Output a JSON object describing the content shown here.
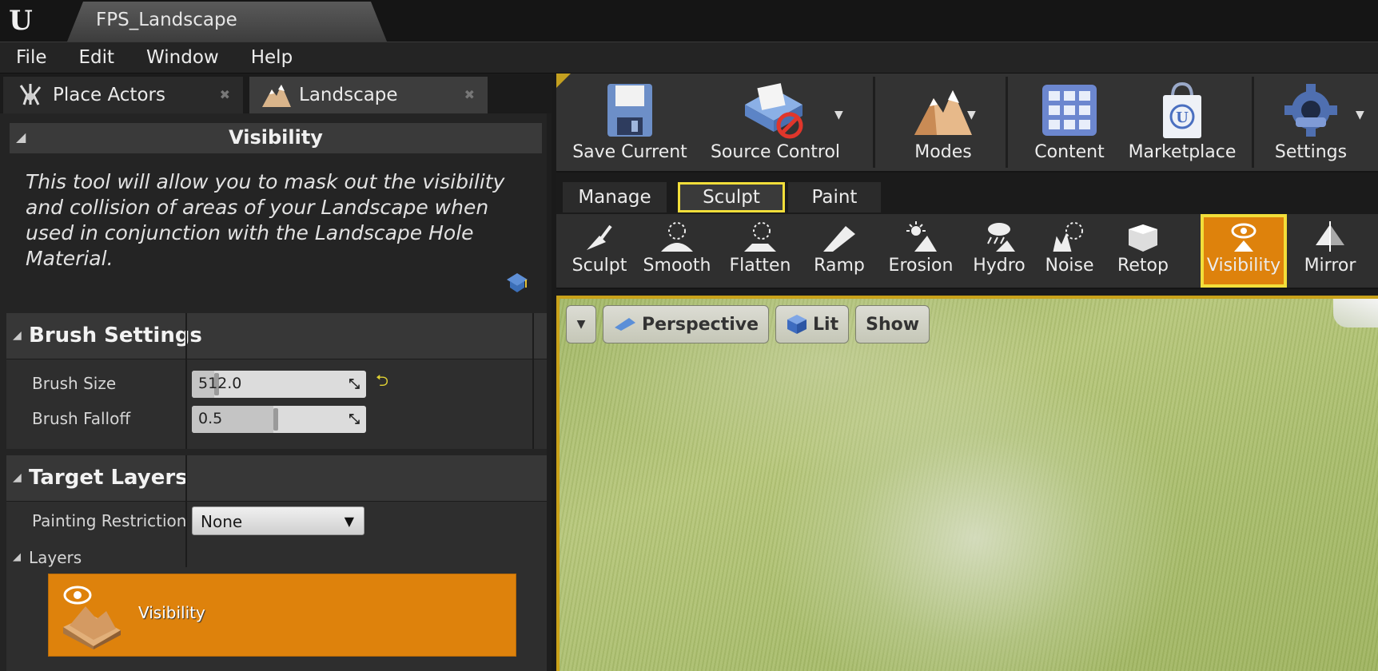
{
  "app": {
    "document_tab": "FPS_Landscape"
  },
  "menu": [
    "File",
    "Edit",
    "Window",
    "Help"
  ],
  "panel_tabs": {
    "place_actors": "Place Actors",
    "landscape": "Landscape"
  },
  "tool": {
    "title": "Visibility",
    "description": "This tool will allow you to mask out the visibility and collision of areas of your Landscape when used in conjunction with the Landscape Hole Material."
  },
  "brush_settings": {
    "title": "Brush Settings",
    "brush_size_label": "Brush Size",
    "brush_size_value": "512.0",
    "brush_falloff_label": "Brush Falloff",
    "brush_falloff_value": "0.5"
  },
  "target_layers": {
    "title": "Target Layers",
    "painting_restriction_label": "Painting Restriction",
    "painting_restriction_value": "None",
    "layers_label": "Layers",
    "layer_name": "Visibility"
  },
  "toolbar": {
    "save_current": "Save Current",
    "source_control": "Source Control",
    "modes": "Modes",
    "content": "Content",
    "marketplace": "Marketplace",
    "settings": "Settings"
  },
  "mode_tabs": [
    "Manage",
    "Sculpt",
    "Paint"
  ],
  "sculpt_tools": [
    "Sculpt",
    "Smooth",
    "Flatten",
    "Ramp",
    "Erosion",
    "Hydro",
    "Noise",
    "Retop",
    "Visibility",
    "Mirror"
  ],
  "viewport": {
    "perspective": "Perspective",
    "lit": "Lit",
    "show": "Show"
  },
  "colors": {
    "accent_orange": "#de820c",
    "highlight_yellow": "#f2de3a"
  }
}
